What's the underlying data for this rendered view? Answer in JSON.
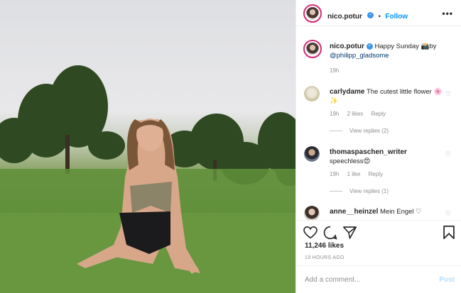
{
  "post": {
    "author": "nico.potur",
    "follow_label": "Follow",
    "separator": "•",
    "more_icon": "more-horizontal-icon",
    "caption_text": "Happy Sunday 📸by",
    "caption_mention": "@philipp_gladsome",
    "caption_time": "19h",
    "likes": "11,246 likes",
    "posted_ago": "19 HOURS AGO",
    "add_comment_placeholder": "Add a comment...",
    "post_label": "Post"
  },
  "comments": [
    {
      "user": "carlydame",
      "text": "The cutest little flower 🌸✨",
      "time": "19h",
      "likes": "2 likes",
      "reply": "Reply",
      "view_replies": "View replies (2)"
    },
    {
      "user": "thomaspaschen_writer",
      "text": "speechless😍",
      "time": "19h",
      "likes": "1 like",
      "reply": "Reply",
      "view_replies": "View replies (1)"
    },
    {
      "user": "anne__heinzel",
      "text": "Mein Engel ♡",
      "time": "",
      "likes": "",
      "reply": "",
      "view_replies": ""
    }
  ],
  "icons": [
    "heart-icon",
    "comment-icon",
    "share-icon",
    "bookmark-icon",
    "verified-badge-icon"
  ],
  "colors": {
    "accent": "#0095f6",
    "verified": "#3897f0",
    "text": "#262626",
    "muted": "#8e8e8e",
    "post_disabled": "#b2dffc"
  }
}
